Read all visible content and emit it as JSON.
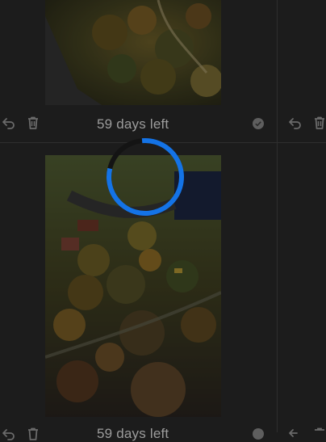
{
  "grid": {
    "items": [
      {
        "expiry_label": "59 days left"
      },
      {
        "expiry_label": "59 days left"
      }
    ]
  },
  "icons": {
    "restore": "undo-arrow-icon",
    "delete": "trash-icon",
    "select": "circle-check-icon",
    "loading": "spinner-icon"
  },
  "colors": {
    "background": "#1c1c1c",
    "spinner_accent": "#1473e6",
    "spinner_track": "#141414",
    "label_text": "#9c9c9c",
    "icon": "#6a6a6a"
  },
  "loading": {
    "progress": 0.8
  }
}
